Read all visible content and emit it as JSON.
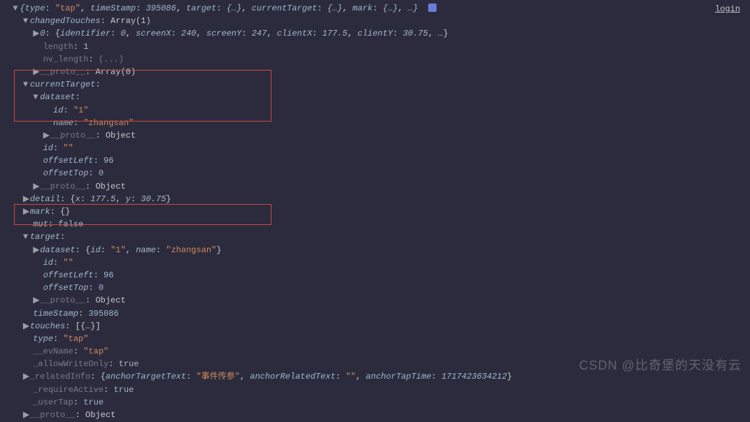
{
  "topbar": {
    "login": "login"
  },
  "root": {
    "summary": {
      "type_k": "type",
      "type_v": "\"tap\"",
      "ts_k": "timeStamp",
      "ts_v": "395086",
      "target_k": "target",
      "target_v": "{…}",
      "ct_k": "currentTarget",
      "ct_v": "{…}",
      "mark_k": "mark",
      "mark_v": "{…}",
      "more": "…"
    }
  },
  "changedTouches": {
    "key": "changedTouches",
    "val": "Array(1)"
  },
  "ct_item0": {
    "idx": "0",
    "id_k": "identifier",
    "id_v": "0",
    "sx_k": "screenX",
    "sx_v": "240",
    "sy_k": "screenY",
    "sy_v": "247",
    "cx_k": "clientX",
    "cx_v": "177.5",
    "cy_k": "clientY",
    "cy_v": "30.75",
    "more": "…"
  },
  "length": {
    "key": "length",
    "val": "1"
  },
  "nv_length": {
    "key": "nv_length",
    "val": "(...)"
  },
  "proto_arr": {
    "key": "__proto__",
    "val": "Array(0)"
  },
  "currentTarget": {
    "key": "currentTarget",
    "colon": ":"
  },
  "dataset": {
    "key": "dataset",
    "colon": ":"
  },
  "ds_id": {
    "key": "id",
    "val": "\"1\""
  },
  "ds_name": {
    "key": "name",
    "val": "\"zhangsan\""
  },
  "proto_obj": {
    "key": "__proto__",
    "val": "Object"
  },
  "id_empty": {
    "key": "id",
    "val": "\"\""
  },
  "offsetLeft": {
    "key": "offsetLeft",
    "val": "96"
  },
  "offsetTop": {
    "key": "offsetTop",
    "val": "0"
  },
  "detail": {
    "key": "detail",
    "x_k": "x",
    "x_v": "177.5",
    "y_k": "y",
    "y_v": "30.75"
  },
  "mark": {
    "key": "mark",
    "val": "{}"
  },
  "mut": {
    "key": "mut",
    "val": "false"
  },
  "target": {
    "key": "target",
    "colon": ":"
  },
  "t_dataset": {
    "key": "dataset",
    "id_k": "id",
    "id_v": "\"1\"",
    "name_k": "name",
    "name_v": "\"zhangsan\""
  },
  "timeStamp": {
    "key": "timeStamp",
    "val": "395086"
  },
  "touches": {
    "key": "touches",
    "val": "[{…}]"
  },
  "type_tap": {
    "key": "type",
    "val": "\"tap\""
  },
  "evName": {
    "key": "__evName",
    "val": "\"tap\""
  },
  "allowWriteOnly": {
    "key": "_allowWriteOnly",
    "val": "true"
  },
  "relatedInfo": {
    "key": "_relatedInfo",
    "att_k": "anchorTargetText",
    "att_v": "\"事件传参\"",
    "art_k": "anchorRelatedText",
    "art_v": "\"\"",
    "atap_k": "anchorTapTime",
    "atap_v": "1717423634212"
  },
  "requireActive": {
    "key": "_requireActive",
    "val": "true"
  },
  "userTap": {
    "key": "_userTap",
    "val": "true"
  },
  "watermark": "CSDN @比奇堡的天没有云",
  "glyphs": {
    "down": "▼",
    "right": "▶"
  }
}
